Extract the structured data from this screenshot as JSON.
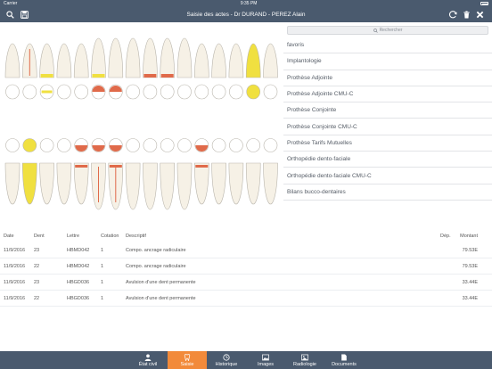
{
  "statusbar": {
    "carrier": "Carrier",
    "time": "9:35 PM"
  },
  "navbar": {
    "title": "Saisie des actes -  Dr DURAND - PEREZ Alain",
    "left_icons": [
      "search-icon",
      "save-icon"
    ],
    "right_icons": [
      "refresh-icon",
      "trash-icon",
      "close-icon"
    ]
  },
  "search": {
    "placeholder": "Rechercher"
  },
  "categories": [
    "favoris",
    "Implantologie",
    "Prothèse Adjointe",
    "Prothèse Adjointe CMU-C",
    "Prothèse Conjointe",
    "Prothèse Conjointe CMU-C",
    "Prothèse Tarifs Mutuelles",
    "Orthopédie dento-faciale",
    "Orthopédie dento-faciale CMU-C",
    "Bilans bucco-dentaires"
  ],
  "table": {
    "headers": {
      "date": "Date",
      "dent": "Dent",
      "lettre": "Lettre",
      "cotation": "Cotation",
      "description": "Descriptif",
      "dep": "Dép.",
      "montant": "Montant"
    },
    "rows": [
      {
        "date": "11/9/2016",
        "dent": "23",
        "lettre": "HBMD042",
        "cotation": "1",
        "description": "Compo. ancrage radiculaire",
        "dep": "",
        "montant": "79.53E"
      },
      {
        "date": "11/9/2016",
        "dent": "22",
        "lettre": "HBMD042",
        "cotation": "1",
        "description": "Compo. ancrage radiculaire",
        "dep": "",
        "montant": "79.53E"
      },
      {
        "date": "11/9/2016",
        "dent": "23",
        "lettre": "HBGD036",
        "cotation": "1",
        "description": "Avulsion d'une dent permanente",
        "dep": "",
        "montant": "33.44E"
      },
      {
        "date": "11/9/2016",
        "dent": "22",
        "lettre": "HBGD036",
        "cotation": "1",
        "description": "Avulsion d'une dent permanente",
        "dep": "",
        "montant": "33.44E"
      }
    ]
  },
  "tabs": [
    {
      "label": "État civil",
      "icon": "person-icon",
      "active": false
    },
    {
      "label": "Saisie",
      "icon": "tooth-icon",
      "active": true
    },
    {
      "label": "Historique",
      "icon": "clock-icon",
      "active": false
    },
    {
      "label": "Images",
      "icon": "image-icon",
      "active": false
    },
    {
      "label": "Radiologie",
      "icon": "xray-icon",
      "active": false
    },
    {
      "label": "Documents",
      "icon": "document-icon",
      "active": false
    }
  ],
  "colors": {
    "bar": "#4a5a6e",
    "active_tab": "#f28a3a",
    "tooth_fill": "#f6f1e6",
    "crown_yellow": "#f0e040",
    "treatment_red": "#e06a4a"
  }
}
